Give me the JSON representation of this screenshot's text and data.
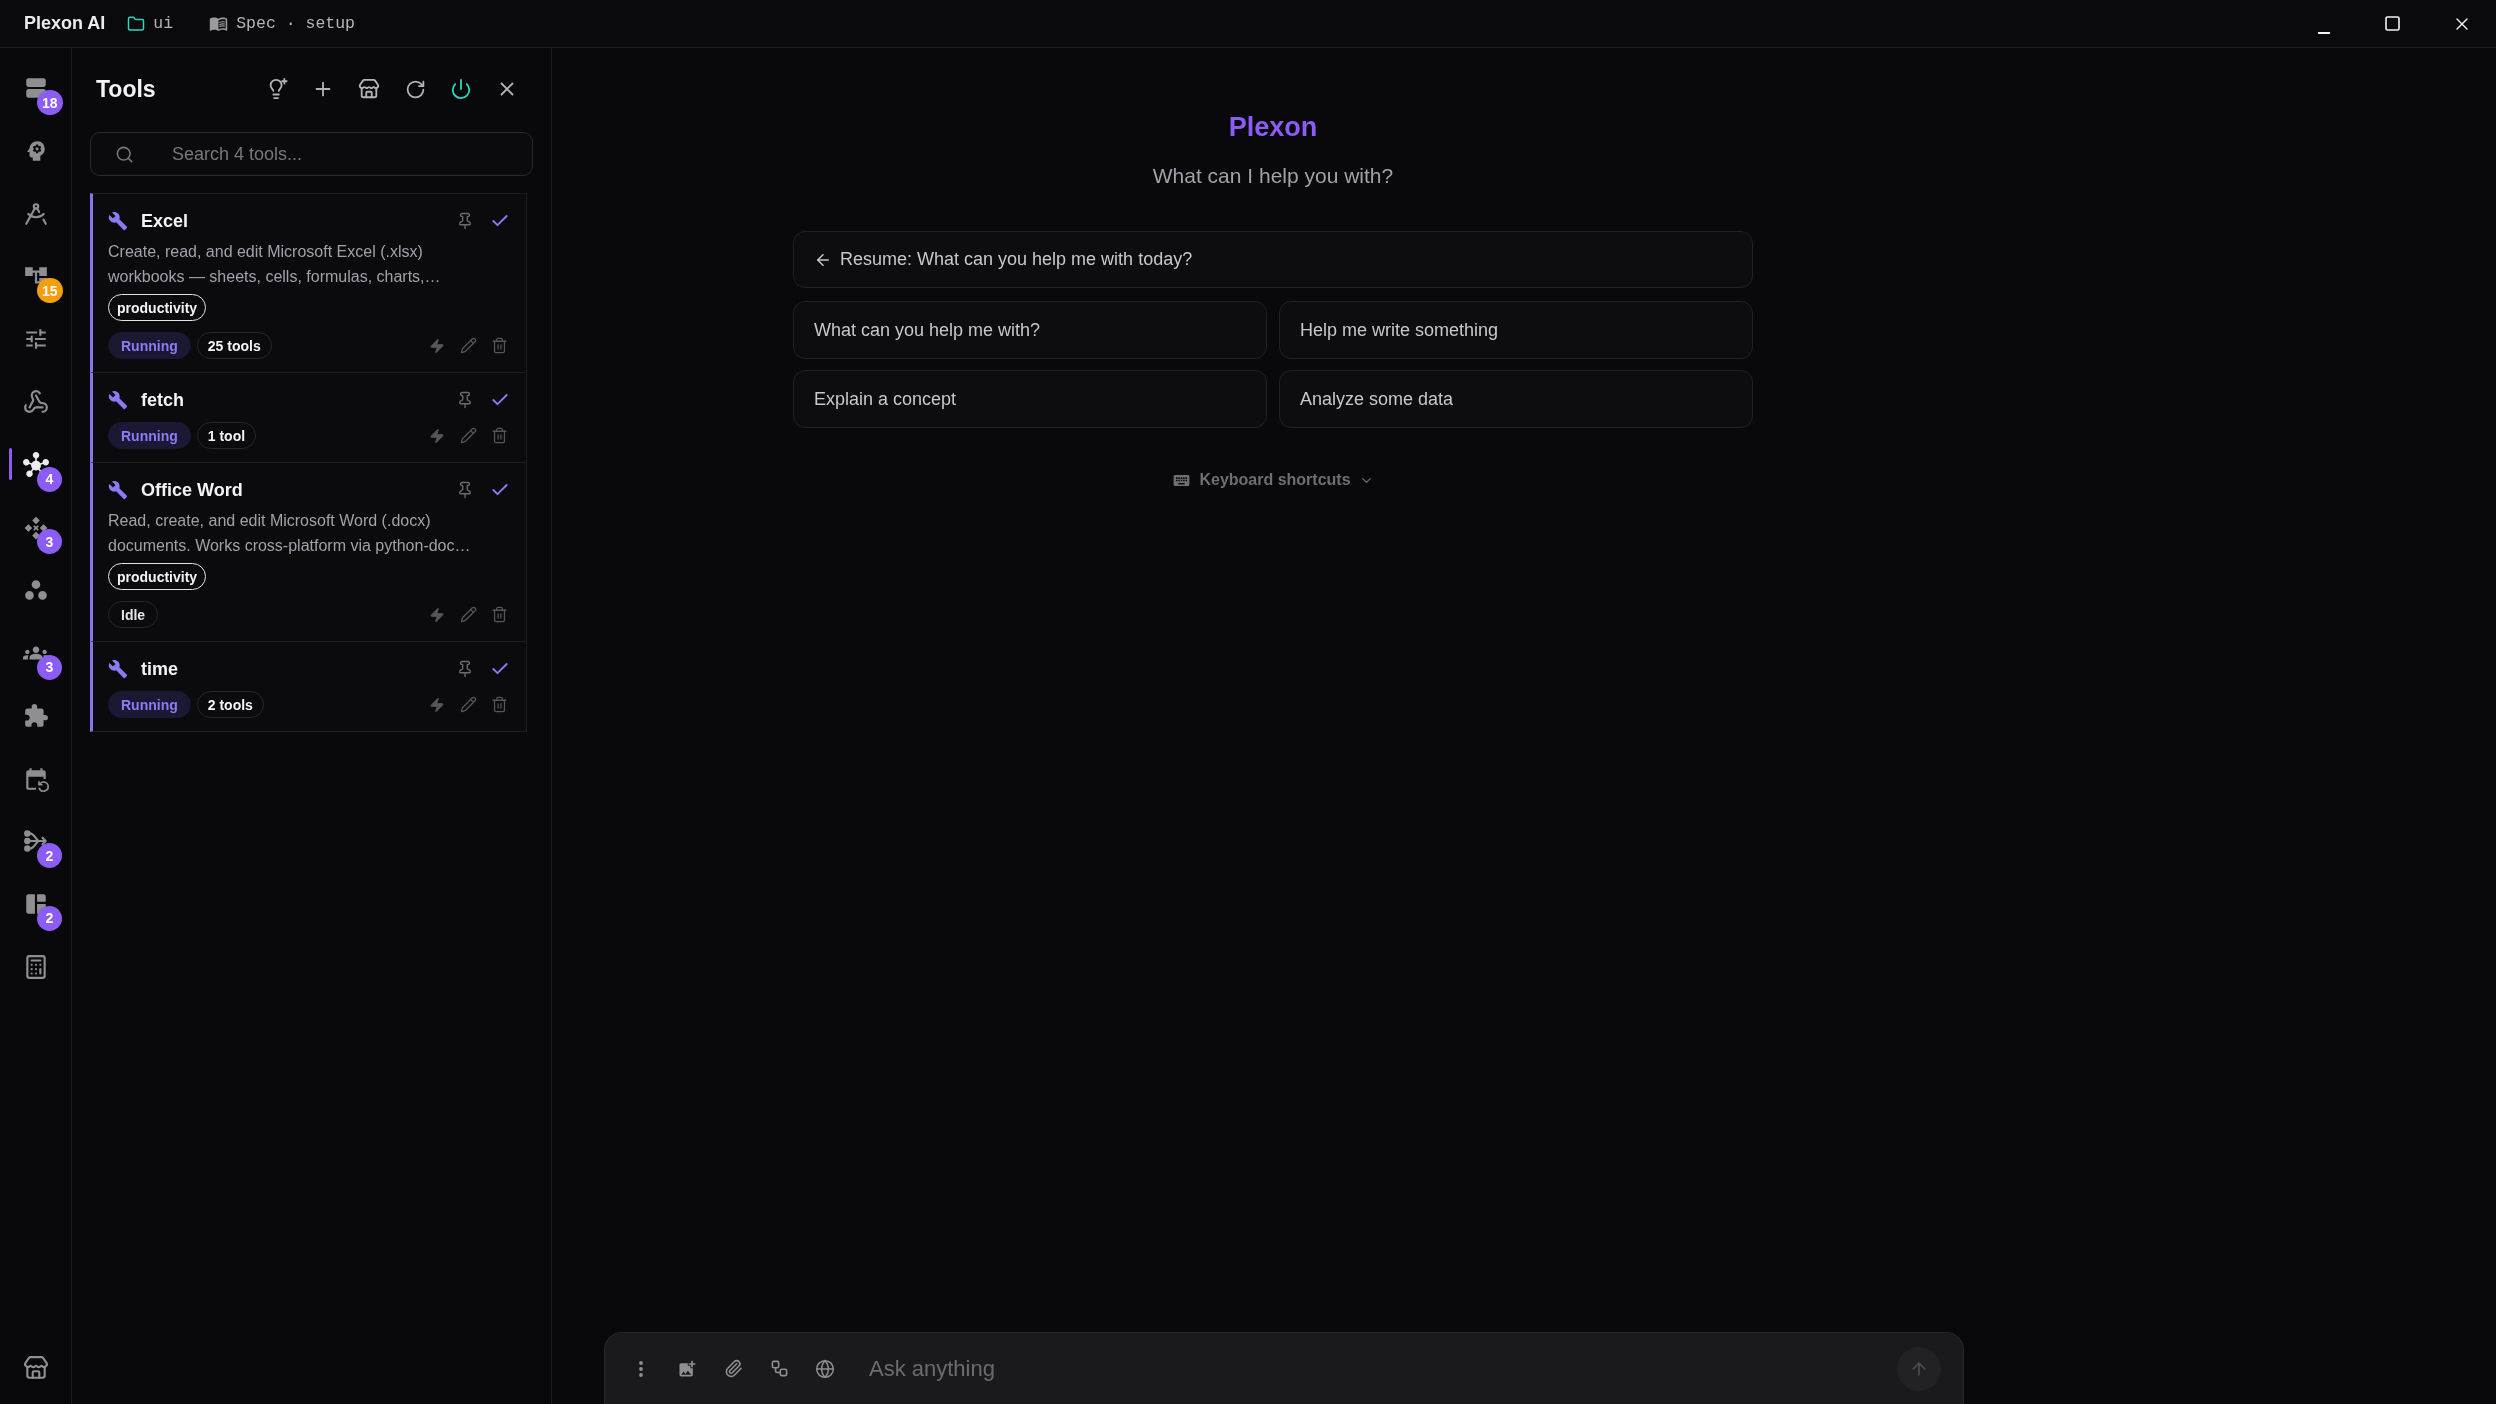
{
  "title_bar": {
    "app_name": "Plexon AI",
    "folder": "ui",
    "document": "Spec · setup"
  },
  "nav_rail": {
    "items": [
      {
        "selected": false,
        "badge": "18",
        "color": "#8b5cf6"
      },
      {
        "selected": false
      },
      {
        "selected": false
      },
      {
        "selected": false,
        "badge": "15",
        "color": "#f59e0b"
      },
      {
        "selected": false
      },
      {
        "selected": false
      },
      {
        "selected": true,
        "badge": "4",
        "color": "#8b5cf6"
      },
      {
        "selected": false,
        "badge": "3",
        "color": "#8b5cf6"
      },
      {
        "selected": false
      },
      {
        "selected": false,
        "badge": "3",
        "color": "#8b5cf6"
      },
      {
        "selected": false
      },
      {
        "selected": false
      },
      {
        "selected": false,
        "badge": "2",
        "color": "#8b5cf6"
      },
      {
        "selected": false,
        "badge": "2",
        "color": "#8b5cf6"
      },
      {
        "selected": false
      }
    ],
    "footer_items": [
      {
        "selected": false
      }
    ]
  },
  "tools_panel": {
    "title": "Tools",
    "search": {
      "placeholder": "Search 4 tools..."
    },
    "tools": [
      {
        "name": "Excel",
        "pinned": false,
        "enabled": true,
        "description": "Create, read, and edit Microsoft Excel (.xlsx)\nworkbooks — sheets, cells, formulas, charts,…",
        "tags": [
          "productivity"
        ],
        "status": "Running",
        "running": true,
        "count": "25 tools"
      },
      {
        "name": "fetch",
        "pinned": false,
        "enabled": true,
        "status": "Running",
        "running": true,
        "count": "1 tool"
      },
      {
        "name": "Office Word",
        "pinned": false,
        "enabled": true,
        "description": "Read, create, and edit Microsoft Word (.docx)\ndocuments. Works cross-platform via python-doc…",
        "tags": [
          "productivity"
        ],
        "status": "Idle",
        "running": false
      },
      {
        "name": "time",
        "pinned": false,
        "enabled": true,
        "status": "Running",
        "running": true,
        "count": "2 tools"
      }
    ]
  },
  "main": {
    "brand": "Plexon",
    "subtitle": "What can I help you with?",
    "resume": "Resume: What can you help me with today?",
    "suggestions": [
      "What can you help me with?",
      "Help me write something",
      "Explain a concept",
      "Analyze some data"
    ],
    "shortcuts": {
      "label": "Keyboard shortcuts",
      "expanded": false
    }
  },
  "composer": {
    "placeholder": "Ask anything",
    "send_disabled": true
  }
}
